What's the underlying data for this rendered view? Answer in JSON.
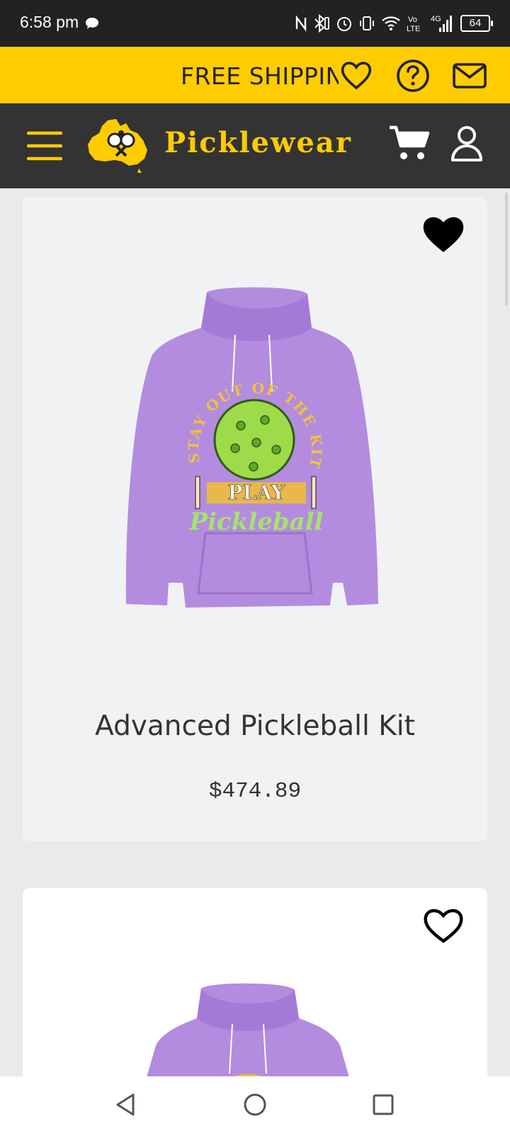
{
  "status_bar": {
    "time": "6:58 pm",
    "battery": "64",
    "icons": [
      "chat-bubble-icon",
      "nfc-icon",
      "bluetooth-icon",
      "alarm-icon",
      "vibrate-icon",
      "wifi-icon",
      "volte-icon",
      "signal-4g-icon",
      "battery-icon"
    ]
  },
  "promo": {
    "text": "FREE SHIPPING",
    "icons": [
      "heart-outline-icon",
      "help-circle-icon",
      "mail-icon"
    ],
    "color": "#ffcc00"
  },
  "nav": {
    "brand": "Picklewear",
    "icons": [
      "hamburger-menu-icon",
      "logo-icon",
      "cart-icon",
      "user-icon"
    ],
    "background": "#333333",
    "accent": "#ffcc00"
  },
  "products": [
    {
      "title": "Advanced Pickleball Kit",
      "price": "$474.89",
      "favorited": true,
      "image_text": {
        "arc": "STAY OUT OF THE KITCHEN",
        "banner": "PLAY",
        "script": "Pickleball"
      }
    },
    {
      "title": "",
      "price": "",
      "favorited": false
    }
  ],
  "system_nav": {
    "icons": [
      "back-icon",
      "home-icon",
      "recents-icon"
    ]
  }
}
